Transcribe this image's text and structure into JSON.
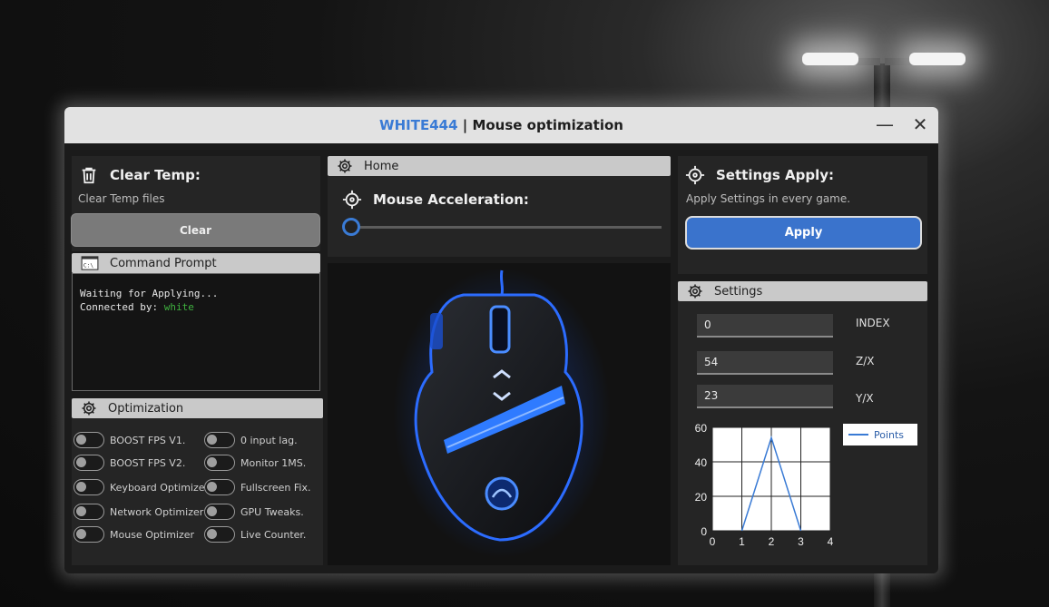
{
  "window": {
    "brand": "WHITE444",
    "title_rest": " | Mouse optimization",
    "minimize": "—",
    "close": "✕"
  },
  "clear_temp": {
    "title": "Clear Temp:",
    "subtitle": "Clear Temp files",
    "button": "Clear",
    "icon": "trash-icon"
  },
  "command_prompt": {
    "header": "Command Prompt",
    "icon": "terminal-icon",
    "line1": "Waiting for Applying...",
    "line2_prefix": "Connected by: ",
    "line2_user": "white"
  },
  "optimization": {
    "header": "Optimization",
    "icon": "gear-icon",
    "left": [
      "BOOST FPS V1.",
      "BOOST FPS V2.",
      "Keyboard Optimizer",
      "Network Optimizer",
      "Mouse Optimizer"
    ],
    "right": [
      "0 input lag.",
      "Monitor 1MS.",
      "Fullscreen Fix.",
      "GPU Tweaks.",
      "Live Counter."
    ]
  },
  "home": {
    "header": "Home",
    "icon": "gear-icon",
    "accel_title": "Mouse Acceleration:",
    "accel_icon": "crosshair-icon",
    "accel_value": 0
  },
  "settings_apply": {
    "title": "Settings Apply:",
    "subtitle": "Apply Settings in every game.",
    "button": "Apply",
    "icon": "crosshair-icon"
  },
  "settings": {
    "header": "Settings",
    "icon": "gear-icon",
    "fields": [
      {
        "value": "0",
        "label": "INDEX"
      },
      {
        "value": "54",
        "label": "Z/X"
      },
      {
        "value": "23",
        "label": "Y/X"
      }
    ]
  },
  "chart_data": {
    "type": "line",
    "series": [
      {
        "name": "Points",
        "x": [
          1,
          2,
          3
        ],
        "y": [
          0,
          54,
          0
        ]
      }
    ],
    "xlim": [
      0,
      4
    ],
    "ylim": [
      0,
      60
    ],
    "xticks": [
      "0",
      "1",
      "2",
      "3",
      "4"
    ],
    "yticks": [
      "0",
      "20",
      "40",
      "60"
    ],
    "grid": true,
    "legend": "right",
    "color": "#3a7bd5"
  },
  "colors": {
    "accent": "#3a7bd5",
    "apply_button": "#3a73cc",
    "console_green": "#3fb23f"
  }
}
